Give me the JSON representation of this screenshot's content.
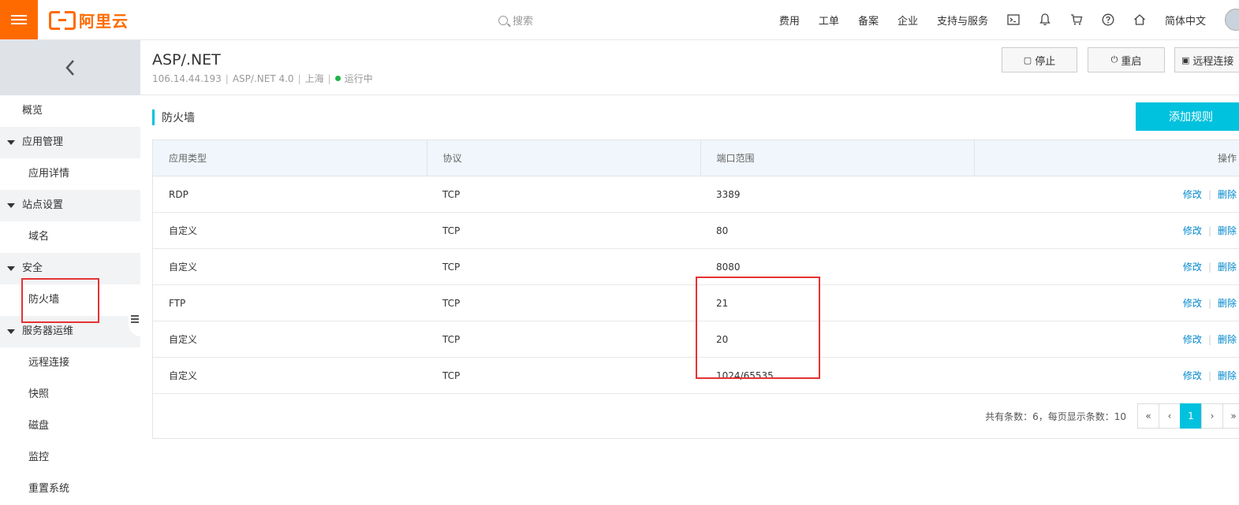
{
  "header": {
    "logo_text": "阿里云",
    "search_placeholder": "搜索",
    "nav": [
      "费用",
      "工单",
      "备案",
      "企业",
      "支持与服务"
    ],
    "language": "简体中文",
    "brand_color": "#ff6a00"
  },
  "sidebar": {
    "items": [
      {
        "label": "概览",
        "level": 1
      },
      {
        "label": "应用管理",
        "level": 1,
        "expandable": true
      },
      {
        "label": "应用详情",
        "level": 2
      },
      {
        "label": "站点设置",
        "level": 1,
        "expandable": true
      },
      {
        "label": "域名",
        "level": 2
      },
      {
        "label": "安全",
        "level": 1,
        "expandable": true
      },
      {
        "label": "防火墙",
        "level": 2,
        "selected": true
      },
      {
        "label": "服务器运维",
        "level": 1,
        "expandable": true
      },
      {
        "label": "远程连接",
        "level": 2
      },
      {
        "label": "快照",
        "level": 2
      },
      {
        "label": "磁盘",
        "level": 2
      },
      {
        "label": "监控",
        "level": 2
      },
      {
        "label": "重置系统",
        "level": 2
      }
    ]
  },
  "instance": {
    "title": "ASP/.NET",
    "ip": "106.14.44.193",
    "app": "ASP/.NET 4.0",
    "region": "上海",
    "status": "运行中",
    "status_color": "#1fb349",
    "actions": [
      "停止",
      "重启",
      "远程连接"
    ]
  },
  "section": {
    "title": "防火墙",
    "add_button": "添加规则",
    "accent_color": "#00c1de"
  },
  "table": {
    "columns": [
      "应用类型",
      "协议",
      "端口范围",
      "操作"
    ],
    "rows": [
      {
        "type": "RDP",
        "protocol": "TCP",
        "ports": "3389"
      },
      {
        "type": "自定义",
        "protocol": "TCP",
        "ports": "80"
      },
      {
        "type": "自定义",
        "protocol": "TCP",
        "ports": "8080"
      },
      {
        "type": "FTP",
        "protocol": "TCP",
        "ports": "21"
      },
      {
        "type": "自定义",
        "protocol": "TCP",
        "ports": "20"
      },
      {
        "type": "自定义",
        "protocol": "TCP",
        "ports": "1024/65535"
      }
    ],
    "row_actions": {
      "edit": "修改",
      "delete": "删除"
    },
    "pager_summary": "共有条数：6，每页显示条数：10",
    "pager": {
      "first": "«",
      "prev": "‹",
      "current": "1",
      "next": "›",
      "last": "»"
    }
  }
}
